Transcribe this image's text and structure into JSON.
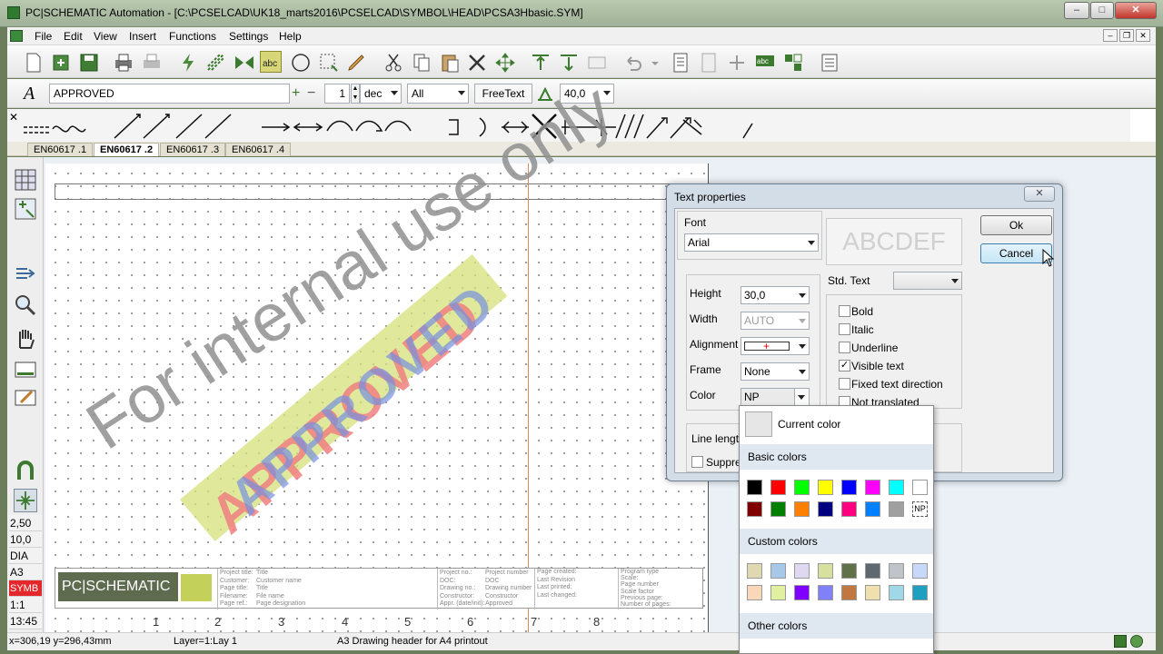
{
  "window": {
    "title": "PC|SCHEMATIC Automation - [C:\\PCSELCAD\\UK18_marts2016\\PCSELCAD\\SYMBOL\\HEAD\\PCSA3Hbasic.SYM]",
    "min": "–",
    "max": "□",
    "close": "✕"
  },
  "menu": [
    "File",
    "Edit",
    "View",
    "Insert",
    "Functions",
    "Settings",
    "Help"
  ],
  "toolbar2": {
    "text_value": "APPROVED",
    "number": "1",
    "dec": "dec",
    "all": "All",
    "freetext": "FreeText",
    "size": "40,0"
  },
  "tabs": [
    "EN60617 .1",
    "EN60617 .2",
    "EN60617 .3",
    "EN60617 .4"
  ],
  "left_status": [
    "2,50",
    "10,0",
    "DIA",
    "A3",
    "SYMB",
    "1:1",
    "13:45"
  ],
  "sheet": {
    "watermark": "For internal use only",
    "stamp": "APPROVED",
    "logo": "PC|SCHEMATIC",
    "columns": [
      "1",
      "2",
      "3",
      "4",
      "5",
      "6",
      "7",
      "8"
    ],
    "title_block": {
      "col1_labels": [
        "Project title:",
        "Customer:",
        "Page title:",
        "Filename:",
        "Page ref.:"
      ],
      "col1_values": [
        "Title",
        "Customer name",
        "Title",
        "File name",
        "Page designation"
      ],
      "col2_labels": [
        "Project no.:",
        "DOC:",
        "Drawing no.:",
        "Constructor:",
        "Appr. (date/init):"
      ],
      "col2_values": [
        "Project number",
        "DOC",
        "Drawing number",
        "Constructor",
        "Approved"
      ],
      "col3_labels": [
        "Page created:",
        "Last Revision",
        "Last printed:",
        "Last changed:"
      ],
      "col4_labels": [
        "Program type",
        "Scale:",
        "Page number",
        "Scale factor",
        "Previous page:",
        "Number of pages:"
      ]
    }
  },
  "status": {
    "coords": "x=306,19 y=296,43mm",
    "layer": "Layer=1:Lay 1",
    "description": "A3 Drawing header for A4 printout"
  },
  "dialog": {
    "title": "Text properties",
    "close": "✕",
    "font_label": "Font",
    "font_value": "Arial",
    "preview": "ABCDEF",
    "ok": "Ok",
    "cancel": "Cancel",
    "height_label": "Height",
    "height_value": "30,0",
    "width_label": "Width",
    "width_value": "AUTO",
    "alignment_label": "Alignment",
    "frame_label": "Frame",
    "frame_value": "None",
    "color_label": "Color",
    "color_value": "NP",
    "std_text_label": "Std. Text",
    "line_length_label": "Line length",
    "suppress_label": "Suppress",
    "checks": [
      {
        "label": "Bold",
        "checked": false
      },
      {
        "label": "Italic",
        "checked": false
      },
      {
        "label": "Underline",
        "checked": false
      },
      {
        "label": "Visible text",
        "checked": true
      },
      {
        "label": "Fixed text direction",
        "checked": false
      },
      {
        "label": "Not translated",
        "checked": false
      }
    ]
  },
  "color_popup": {
    "current_label": "Current color",
    "basic_label": "Basic colors",
    "custom_label": "Custom colors",
    "other_label": "Other colors",
    "np_label": "NP",
    "basic_colors": [
      "#000000",
      "#ff0000",
      "#00ff00",
      "#ffff00",
      "#0000ff",
      "#ff00ff",
      "#00ffff",
      "#ffffff",
      "#800000",
      "#008000",
      "#ff8000",
      "#000080",
      "#ff0080",
      "#0080ff",
      "#a0a0a0",
      "NP"
    ],
    "custom_colors": [
      "#e0d8b0",
      "#a8c8e8",
      "#e0d8f0",
      "#d8e0a0",
      "#607048",
      "#606870",
      "#c0c4c8",
      "#c8d8f8",
      "#f8d8b8",
      "#e0f0a0",
      "#8000ff",
      "#8080f8",
      "#c07840",
      "#f0e0b0",
      "#a0d8e8",
      "#20a0c0"
    ]
  }
}
